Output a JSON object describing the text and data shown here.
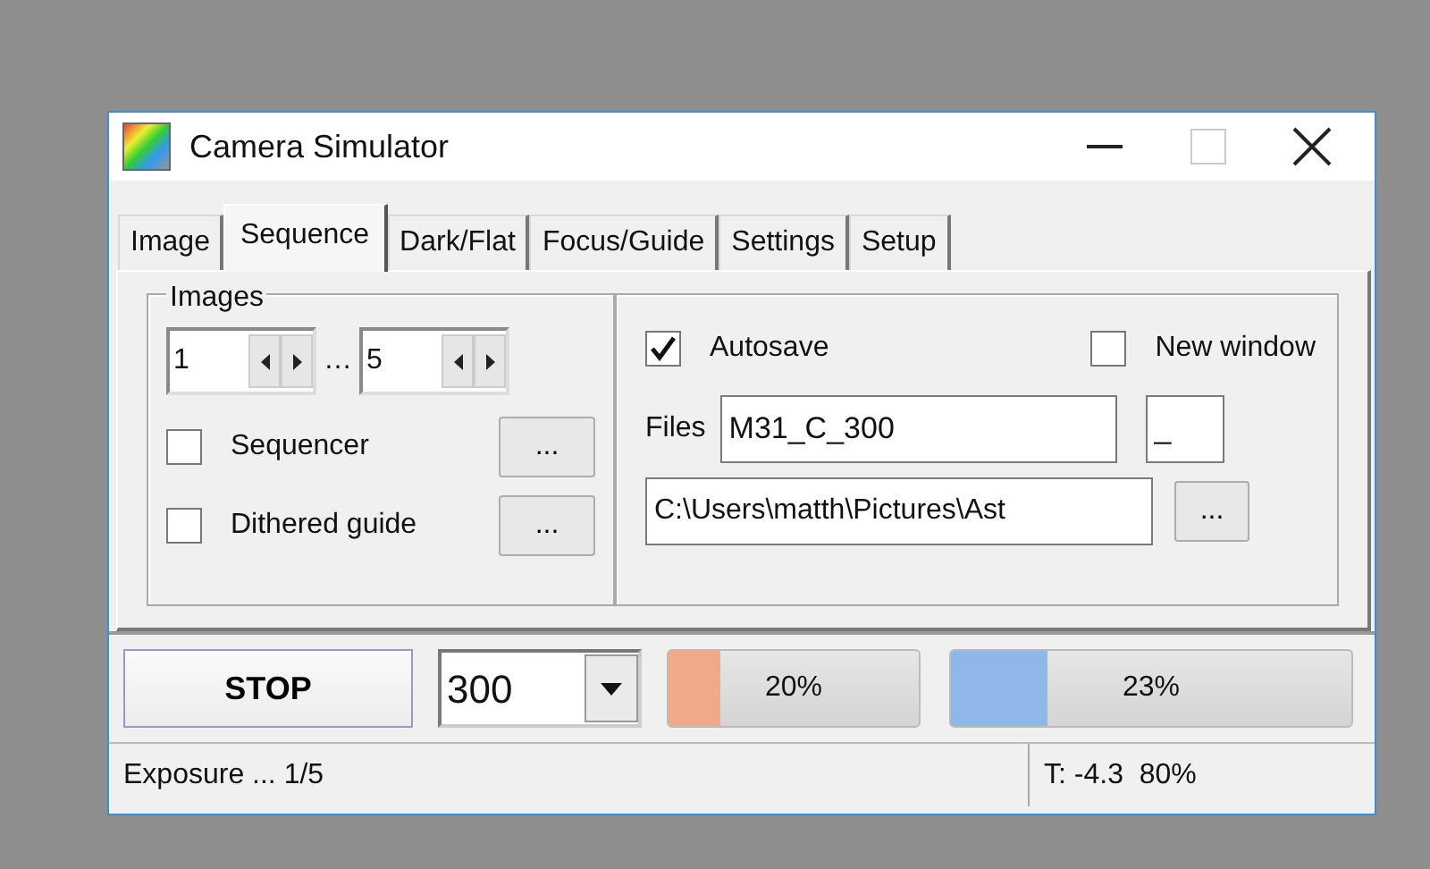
{
  "window": {
    "title": "Camera Simulator"
  },
  "tabs": [
    {
      "label": "Image",
      "selected": false
    },
    {
      "label": "Sequence",
      "selected": true
    },
    {
      "label": "Dark/Flat",
      "selected": false
    },
    {
      "label": "Focus/Guide",
      "selected": false
    },
    {
      "label": "Settings",
      "selected": false
    },
    {
      "label": "Setup",
      "selected": false
    }
  ],
  "images": {
    "title": "Images",
    "from": "1",
    "separator": "…",
    "to": "5"
  },
  "options": [
    {
      "label": "Sequencer",
      "checked": false,
      "button": "..."
    },
    {
      "label": "Dithered guide",
      "checked": false,
      "button": "..."
    }
  ],
  "autosave": {
    "label": "Autosave",
    "checked": true
  },
  "new_window": {
    "label": "New window",
    "checked": false
  },
  "files": {
    "label": "Files",
    "name": "M31_C_300",
    "separator": "_",
    "path": "C:\\Users\\matth\\Pictures\\Ast",
    "browse": "..."
  },
  "controls": {
    "stop": "STOP",
    "exposure": "300"
  },
  "meters": [
    {
      "reading": "20%",
      "level": 0.21,
      "color": "#f2a88a"
    },
    {
      "reading": "23%",
      "level": 0.24,
      "color": "#8fb8e8"
    }
  ],
  "status_bar": {
    "left": "Exposure ... 1/5",
    "right": "T: -4.3  80%"
  }
}
